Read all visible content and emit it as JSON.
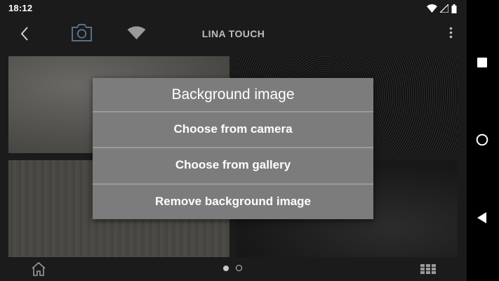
{
  "status": {
    "time": "18:12"
  },
  "appbar": {
    "title": "LINA TOUCH"
  },
  "icons": {
    "back": "back-arrow-icon",
    "camera": "camera-icon",
    "wifi": "wifi-icon",
    "menu": "overflow-menu-icon",
    "home": "home-icon",
    "grid": "grid-icon"
  },
  "dialog": {
    "title": "Background image",
    "options": [
      {
        "label": "Choose from camera"
      },
      {
        "label": "Choose from gallery"
      },
      {
        "label": "Remove background image"
      }
    ]
  },
  "pager": {
    "count": 2,
    "active": 1
  },
  "colors": {
    "dialog_bg": "#7c7c7c",
    "background": "#1b1b1b",
    "camera_accent": "#5a6f86"
  }
}
